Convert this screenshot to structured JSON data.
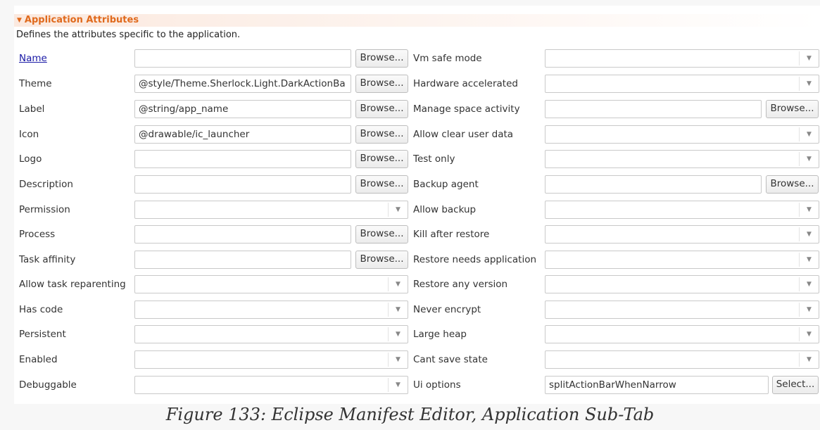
{
  "section": {
    "title": "Application Attributes",
    "description": "Defines the attributes specific to the application."
  },
  "left": {
    "name": {
      "label": "Name",
      "value": "",
      "button": "Browse..."
    },
    "theme": {
      "label": "Theme",
      "value": "@style/Theme.Sherlock.Light.DarkActionBa",
      "button": "Browse..."
    },
    "label": {
      "label": "Label",
      "value": "@string/app_name",
      "button": "Browse..."
    },
    "icon": {
      "label": "Icon",
      "value": "@drawable/ic_launcher",
      "button": "Browse..."
    },
    "logo": {
      "label": "Logo",
      "value": "",
      "button": "Browse..."
    },
    "description": {
      "label": "Description",
      "value": "",
      "button": "Browse..."
    },
    "permission": {
      "label": "Permission",
      "value": ""
    },
    "process": {
      "label": "Process",
      "value": "",
      "button": "Browse..."
    },
    "task_affinity": {
      "label": "Task affinity",
      "value": "",
      "button": "Browse..."
    },
    "allow_task_reparenting": {
      "label": "Allow task reparenting",
      "value": ""
    },
    "has_code": {
      "label": "Has code",
      "value": ""
    },
    "persistent": {
      "label": "Persistent",
      "value": ""
    },
    "enabled": {
      "label": "Enabled",
      "value": ""
    },
    "debuggable": {
      "label": "Debuggable",
      "value": ""
    }
  },
  "right": {
    "vm_safe_mode": {
      "label": "Vm safe mode",
      "value": ""
    },
    "hardware_accelerated": {
      "label": "Hardware accelerated",
      "value": ""
    },
    "manage_space_activity": {
      "label": "Manage space activity",
      "value": "",
      "button": "Browse..."
    },
    "allow_clear_user_data": {
      "label": "Allow clear user data",
      "value": ""
    },
    "test_only": {
      "label": "Test only",
      "value": ""
    },
    "backup_agent": {
      "label": "Backup agent",
      "value": "",
      "button": "Browse..."
    },
    "allow_backup": {
      "label": "Allow backup",
      "value": ""
    },
    "kill_after_restore": {
      "label": "Kill after restore",
      "value": ""
    },
    "restore_needs_application": {
      "label": "Restore needs application",
      "value": ""
    },
    "restore_any_version": {
      "label": "Restore any version",
      "value": ""
    },
    "never_encrypt": {
      "label": "Never encrypt",
      "value": ""
    },
    "large_heap": {
      "label": "Large heap",
      "value": ""
    },
    "cant_save_state": {
      "label": "Cant save state",
      "value": ""
    },
    "ui_options": {
      "label": "Ui options",
      "value": "splitActionBarWhenNarrow",
      "button": "Select..."
    }
  },
  "caption": "Figure 133: Eclipse Manifest Editor, Application Sub-Tab"
}
